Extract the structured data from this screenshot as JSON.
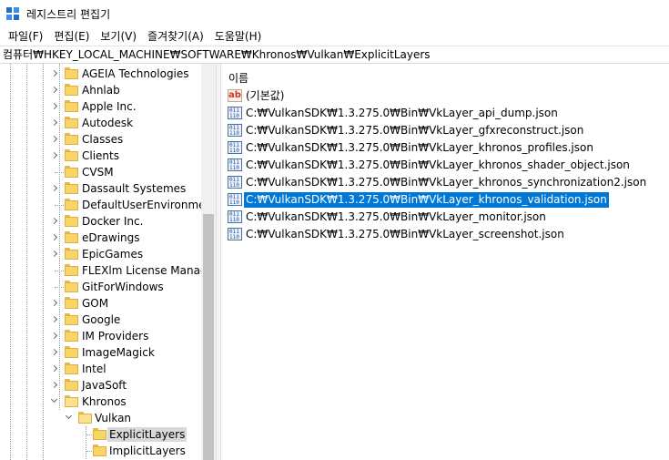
{
  "window": {
    "title": "레지스트리 편집기"
  },
  "menu": [
    "파일(F)",
    "편집(E)",
    "보기(V)",
    "즐겨찾기(A)",
    "도움말(H)"
  ],
  "address": "컴퓨터₩HKEY_LOCAL_MACHINE₩SOFTWARE₩Khronos₩Vulkan₩ExplicitLayers",
  "tree": {
    "items": [
      {
        "label": "AGEIA Technologies",
        "expander": "collapsed"
      },
      {
        "label": "Ahnlab",
        "expander": "collapsed"
      },
      {
        "label": "Apple Inc.",
        "expander": "collapsed"
      },
      {
        "label": "Autodesk",
        "expander": "collapsed"
      },
      {
        "label": "Classes",
        "expander": "collapsed"
      },
      {
        "label": "Clients",
        "expander": "collapsed"
      },
      {
        "label": "CVSM",
        "expander": "none"
      },
      {
        "label": "Dassault Systemes",
        "expander": "collapsed"
      },
      {
        "label": "DefaultUserEnvironment",
        "expander": "none"
      },
      {
        "label": "Docker Inc.",
        "expander": "collapsed"
      },
      {
        "label": "eDrawings",
        "expander": "collapsed"
      },
      {
        "label": "EpicGames",
        "expander": "collapsed"
      },
      {
        "label": "FLEXlm License Manager",
        "expander": "none"
      },
      {
        "label": "GitForWindows",
        "expander": "none"
      },
      {
        "label": "GOM",
        "expander": "collapsed"
      },
      {
        "label": "Google",
        "expander": "collapsed"
      },
      {
        "label": "IM Providers",
        "expander": "collapsed"
      },
      {
        "label": "ImageMagick",
        "expander": "collapsed"
      },
      {
        "label": "Intel",
        "expander": "collapsed"
      },
      {
        "label": "JavaSoft",
        "expander": "collapsed"
      },
      {
        "label": "Khronos",
        "expander": "expanded"
      }
    ],
    "vulkan": {
      "label": "Vulkan",
      "expander": "expanded"
    },
    "children": [
      {
        "label": "ExplicitLayers",
        "selected": true
      },
      {
        "label": "ImplicitLayers",
        "selected": false
      }
    ]
  },
  "list": {
    "column_name": "이름",
    "default_value": "(기본값)",
    "values": [
      {
        "name": "C:₩VulkanSDK₩1.3.275.0₩Bin₩VkLayer_api_dump.json",
        "selected": false
      },
      {
        "name": "C:₩VulkanSDK₩1.3.275.0₩Bin₩VkLayer_gfxreconstruct.json",
        "selected": false
      },
      {
        "name": "C:₩VulkanSDK₩1.3.275.0₩Bin₩VkLayer_khronos_profiles.json",
        "selected": false
      },
      {
        "name": "C:₩VulkanSDK₩1.3.275.0₩Bin₩VkLayer_khronos_shader_object.json",
        "selected": false
      },
      {
        "name": "C:₩VulkanSDK₩1.3.275.0₩Bin₩VkLayer_khronos_synchronization2.json",
        "selected": false
      },
      {
        "name": "C:₩VulkanSDK₩1.3.275.0₩Bin₩VkLayer_khronos_validation.json",
        "selected": true
      },
      {
        "name": "C:₩VulkanSDK₩1.3.275.0₩Bin₩VkLayer_monitor.json",
        "selected": false
      },
      {
        "name": "C:₩VulkanSDK₩1.3.275.0₩Bin₩VkLayer_screenshot.json",
        "selected": false
      }
    ]
  },
  "colors": {
    "selection": "#0078d7",
    "folder": "#f8d56b",
    "tree_selection": "#d9d9d9"
  },
  "icons": {
    "app": "registry-editor-icon",
    "folder": "folder-icon",
    "string_value": "string-value-icon",
    "binary_value": "binary-value-icon"
  }
}
